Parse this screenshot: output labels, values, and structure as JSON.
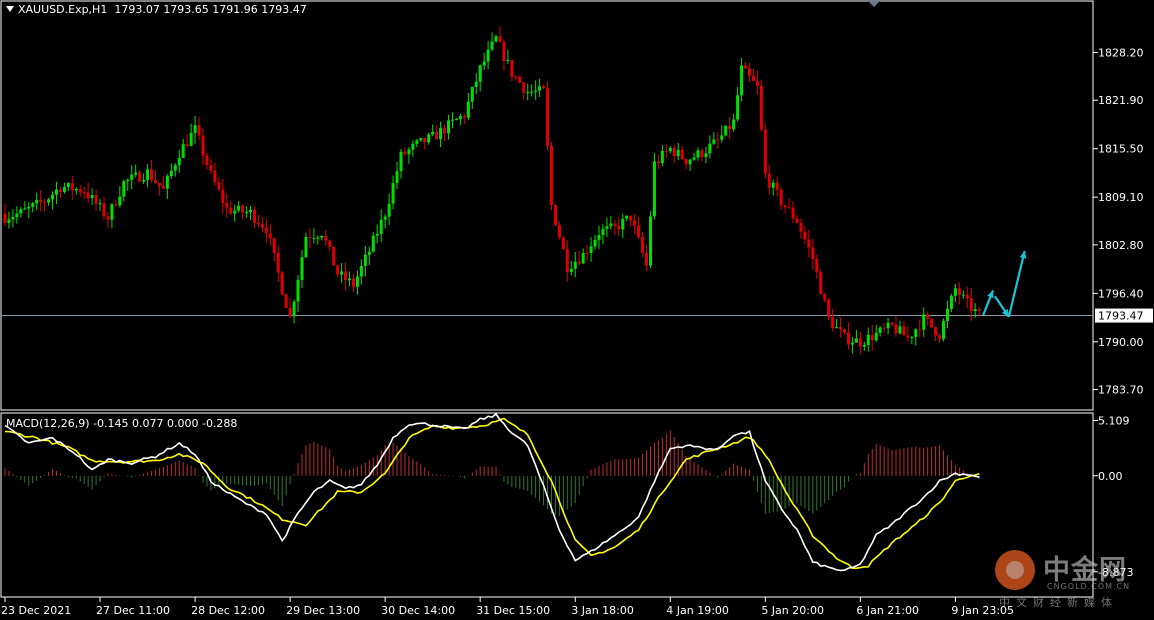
{
  "header": {
    "symbol": "XAUUSD.Exp,H1",
    "ohlc": "1793.07 1793.65 1791.96 1793.47"
  },
  "macd_header": "MACD(12,26,9) -0.145 0.077 0.000 -0.288",
  "watermark": {
    "cn": "中金网",
    "en": "CNGOLD.COM.CN",
    "sub": "中文财经新媒体"
  },
  "colors": {
    "background": "#000000",
    "bull_candle": "#00e000",
    "bear_candle": "#e00000",
    "current_price_line": "#8a9ba8",
    "macd_line": "#ffffff",
    "signal_line": "#ffff00",
    "hist_positive": "#c03030",
    "hist_negative": "#2f7a2f",
    "arrow": "#18c4d6",
    "frame": "#ffffff"
  },
  "chart_data": [
    {
      "type": "candlestick",
      "ylim": [
        1781.0,
        1835.0
      ],
      "current_price": 1793.47,
      "current_price_label": "1793.47",
      "price_ticks": [
        {
          "value": 1828.2,
          "label": "1828.20"
        },
        {
          "value": 1821.9,
          "label": "1821.90"
        },
        {
          "value": 1815.5,
          "label": "1815.50"
        },
        {
          "value": 1809.1,
          "label": "1809.10"
        },
        {
          "value": 1802.8,
          "label": "1802.80"
        },
        {
          "value": 1796.4,
          "label": "1796.40"
        },
        {
          "value": 1790.0,
          "label": "1790.00"
        },
        {
          "value": 1783.7,
          "label": "1783.70"
        }
      ],
      "time_labels": [
        {
          "bar": 0,
          "label": "23 Dec 2021"
        },
        {
          "bar": 24,
          "label": "27 Dec 11:00"
        },
        {
          "bar": 48,
          "label": "28 Dec 12:00"
        },
        {
          "bar": 72,
          "label": "29 Dec 13:00"
        },
        {
          "bar": 96,
          "label": "30 Dec 14:00"
        },
        {
          "bar": 120,
          "label": "31 Dec 15:00"
        },
        {
          "bar": 144,
          "label": "3 Jan 18:00"
        },
        {
          "bar": 168,
          "label": "4 Jan 19:00"
        },
        {
          "bar": 192,
          "label": "5 Jan 20:00"
        },
        {
          "bar": 216,
          "label": "6 Jan 21:00"
        },
        {
          "bar": 240,
          "label": "9 Jan 23:05"
        }
      ],
      "bar_count": 247,
      "close_anchors": [
        [
          0,
          1806.5
        ],
        [
          4,
          1807.0
        ],
        [
          10,
          1808.6
        ],
        [
          14,
          1810.5
        ],
        [
          20,
          1810.0
        ],
        [
          26,
          1806.4
        ],
        [
          30,
          1811.0
        ],
        [
          36,
          1812.4
        ],
        [
          40,
          1810.0
        ],
        [
          44,
          1815.0
        ],
        [
          48,
          1818.0
        ],
        [
          52,
          1812.0
        ],
        [
          56,
          1807.5
        ],
        [
          62,
          1807.0
        ],
        [
          66,
          1805.0
        ],
        [
          70,
          1797.0
        ],
        [
          72,
          1793.2
        ],
        [
          76,
          1804.0
        ],
        [
          80,
          1804.5
        ],
        [
          84,
          1799.0
        ],
        [
          88,
          1797.5
        ],
        [
          92,
          1802.0
        ],
        [
          96,
          1807.0
        ],
        [
          100,
          1814.5
        ],
        [
          104,
          1816.0
        ],
        [
          108,
          1817.0
        ],
        [
          112,
          1818.5
        ],
        [
          116,
          1820.0
        ],
        [
          120,
          1826.0
        ],
        [
          124,
          1830.0
        ],
        [
          128,
          1825.5
        ],
        [
          132,
          1823.0
        ],
        [
          136,
          1823.0
        ],
        [
          138,
          1808.0
        ],
        [
          142,
          1800.0
        ],
        [
          146,
          1801.5
        ],
        [
          150,
          1804.5
        ],
        [
          154,
          1805.0
        ],
        [
          158,
          1806.5
        ],
        [
          162,
          1800.0
        ],
        [
          164,
          1813.5
        ],
        [
          168,
          1815.5
        ],
        [
          172,
          1814.0
        ],
        [
          176,
          1815.0
        ],
        [
          180,
          1816.5
        ],
        [
          184,
          1819.0
        ],
        [
          186,
          1826.0
        ],
        [
          190,
          1823.5
        ],
        [
          192,
          1812.0
        ],
        [
          196,
          1808.5
        ],
        [
          200,
          1806.0
        ],
        [
          204,
          1801.0
        ],
        [
          208,
          1793.0
        ],
        [
          212,
          1790.5
        ],
        [
          216,
          1790.0
        ],
        [
          220,
          1791.0
        ],
        [
          224,
          1792.0
        ],
        [
          228,
          1790.5
        ],
        [
          232,
          1793.0
        ],
        [
          236,
          1791.0
        ],
        [
          240,
          1797.0
        ],
        [
          243,
          1795.0
        ],
        [
          246,
          1793.47
        ]
      ],
      "arrows": [
        {
          "from": [
            247,
            1793.5
          ],
          "to": [
            249.5,
            1796.8
          ]
        },
        {
          "from": [
            250,
            1796.0
          ],
          "to": [
            253.5,
            1793.3
          ]
        },
        {
          "from": [
            253.5,
            1793.3
          ],
          "to": [
            257.5,
            1802.0
          ]
        }
      ]
    },
    {
      "type": "macd",
      "ylim": [
        -11.2,
        5.8
      ],
      "ticks": [
        {
          "value": 5.109,
          "label": "5.109"
        },
        {
          "value": 0.0,
          "label": "0.00"
        },
        {
          "value": -8.873,
          "label": "-8.873"
        }
      ],
      "macd_anchors": [
        [
          0,
          4.6
        ],
        [
          6,
          3.0
        ],
        [
          12,
          3.5
        ],
        [
          18,
          2.0
        ],
        [
          22,
          0.5
        ],
        [
          26,
          1.5
        ],
        [
          32,
          1.2
        ],
        [
          38,
          1.8
        ],
        [
          44,
          3.0
        ],
        [
          48,
          2.0
        ],
        [
          52,
          -0.5
        ],
        [
          56,
          -1.5
        ],
        [
          62,
          -2.8
        ],
        [
          66,
          -3.5
        ],
        [
          70,
          -6.0
        ],
        [
          74,
          -3.5
        ],
        [
          78,
          -1.5
        ],
        [
          82,
          -0.5
        ],
        [
          86,
          -1.2
        ],
        [
          90,
          -0.8
        ],
        [
          94,
          1.0
        ],
        [
          98,
          3.5
        ],
        [
          102,
          4.8
        ],
        [
          106,
          4.8
        ],
        [
          112,
          4.5
        ],
        [
          116,
          4.3
        ],
        [
          120,
          5.2
        ],
        [
          124,
          5.6
        ],
        [
          128,
          4.0
        ],
        [
          132,
          2.8
        ],
        [
          136,
          -1.0
        ],
        [
          140,
          -5.0
        ],
        [
          144,
          -7.8
        ],
        [
          148,
          -7.0
        ],
        [
          152,
          -6.0
        ],
        [
          156,
          -5.0
        ],
        [
          160,
          -3.8
        ],
        [
          164,
          -0.5
        ],
        [
          168,
          2.5
        ],
        [
          172,
          2.8
        ],
        [
          176,
          2.6
        ],
        [
          180,
          2.4
        ],
        [
          184,
          3.8
        ],
        [
          188,
          4.0
        ],
        [
          192,
          -0.5
        ],
        [
          196,
          -3.0
        ],
        [
          200,
          -5.0
        ],
        [
          204,
          -8.0
        ],
        [
          208,
          -8.5
        ],
        [
          212,
          -8.8
        ],
        [
          216,
          -8.2
        ],
        [
          220,
          -5.5
        ],
        [
          224,
          -4.5
        ],
        [
          228,
          -3.2
        ],
        [
          232,
          -2.0
        ],
        [
          236,
          -0.5
        ],
        [
          240,
          0.2
        ],
        [
          244,
          0.1
        ],
        [
          246,
          -0.145
        ]
      ],
      "signal_anchors": [
        [
          0,
          4.1
        ],
        [
          8,
          3.5
        ],
        [
          16,
          2.6
        ],
        [
          22,
          1.4
        ],
        [
          30,
          1.3
        ],
        [
          38,
          1.4
        ],
        [
          44,
          2.0
        ],
        [
          50,
          1.2
        ],
        [
          56,
          -1.0
        ],
        [
          64,
          -2.5
        ],
        [
          70,
          -4.0
        ],
        [
          76,
          -4.5
        ],
        [
          84,
          -1.5
        ],
        [
          90,
          -1.5
        ],
        [
          96,
          0.2
        ],
        [
          102,
          3.5
        ],
        [
          108,
          4.6
        ],
        [
          114,
          4.4
        ],
        [
          120,
          4.6
        ],
        [
          126,
          5.2
        ],
        [
          132,
          3.8
        ],
        [
          138,
          -0.5
        ],
        [
          144,
          -6.0
        ],
        [
          148,
          -7.4
        ],
        [
          154,
          -6.6
        ],
        [
          160,
          -5.0
        ],
        [
          166,
          -1.5
        ],
        [
          172,
          1.5
        ],
        [
          178,
          2.3
        ],
        [
          184,
          3.0
        ],
        [
          188,
          3.6
        ],
        [
          192,
          2.0
        ],
        [
          198,
          -2.0
        ],
        [
          204,
          -5.5
        ],
        [
          210,
          -7.6
        ],
        [
          214,
          -8.5
        ],
        [
          218,
          -8.3
        ],
        [
          224,
          -6.2
        ],
        [
          230,
          -4.5
        ],
        [
          236,
          -2.5
        ],
        [
          240,
          -0.5
        ],
        [
          244,
          0.1
        ],
        [
          246,
          0.077
        ]
      ]
    }
  ]
}
